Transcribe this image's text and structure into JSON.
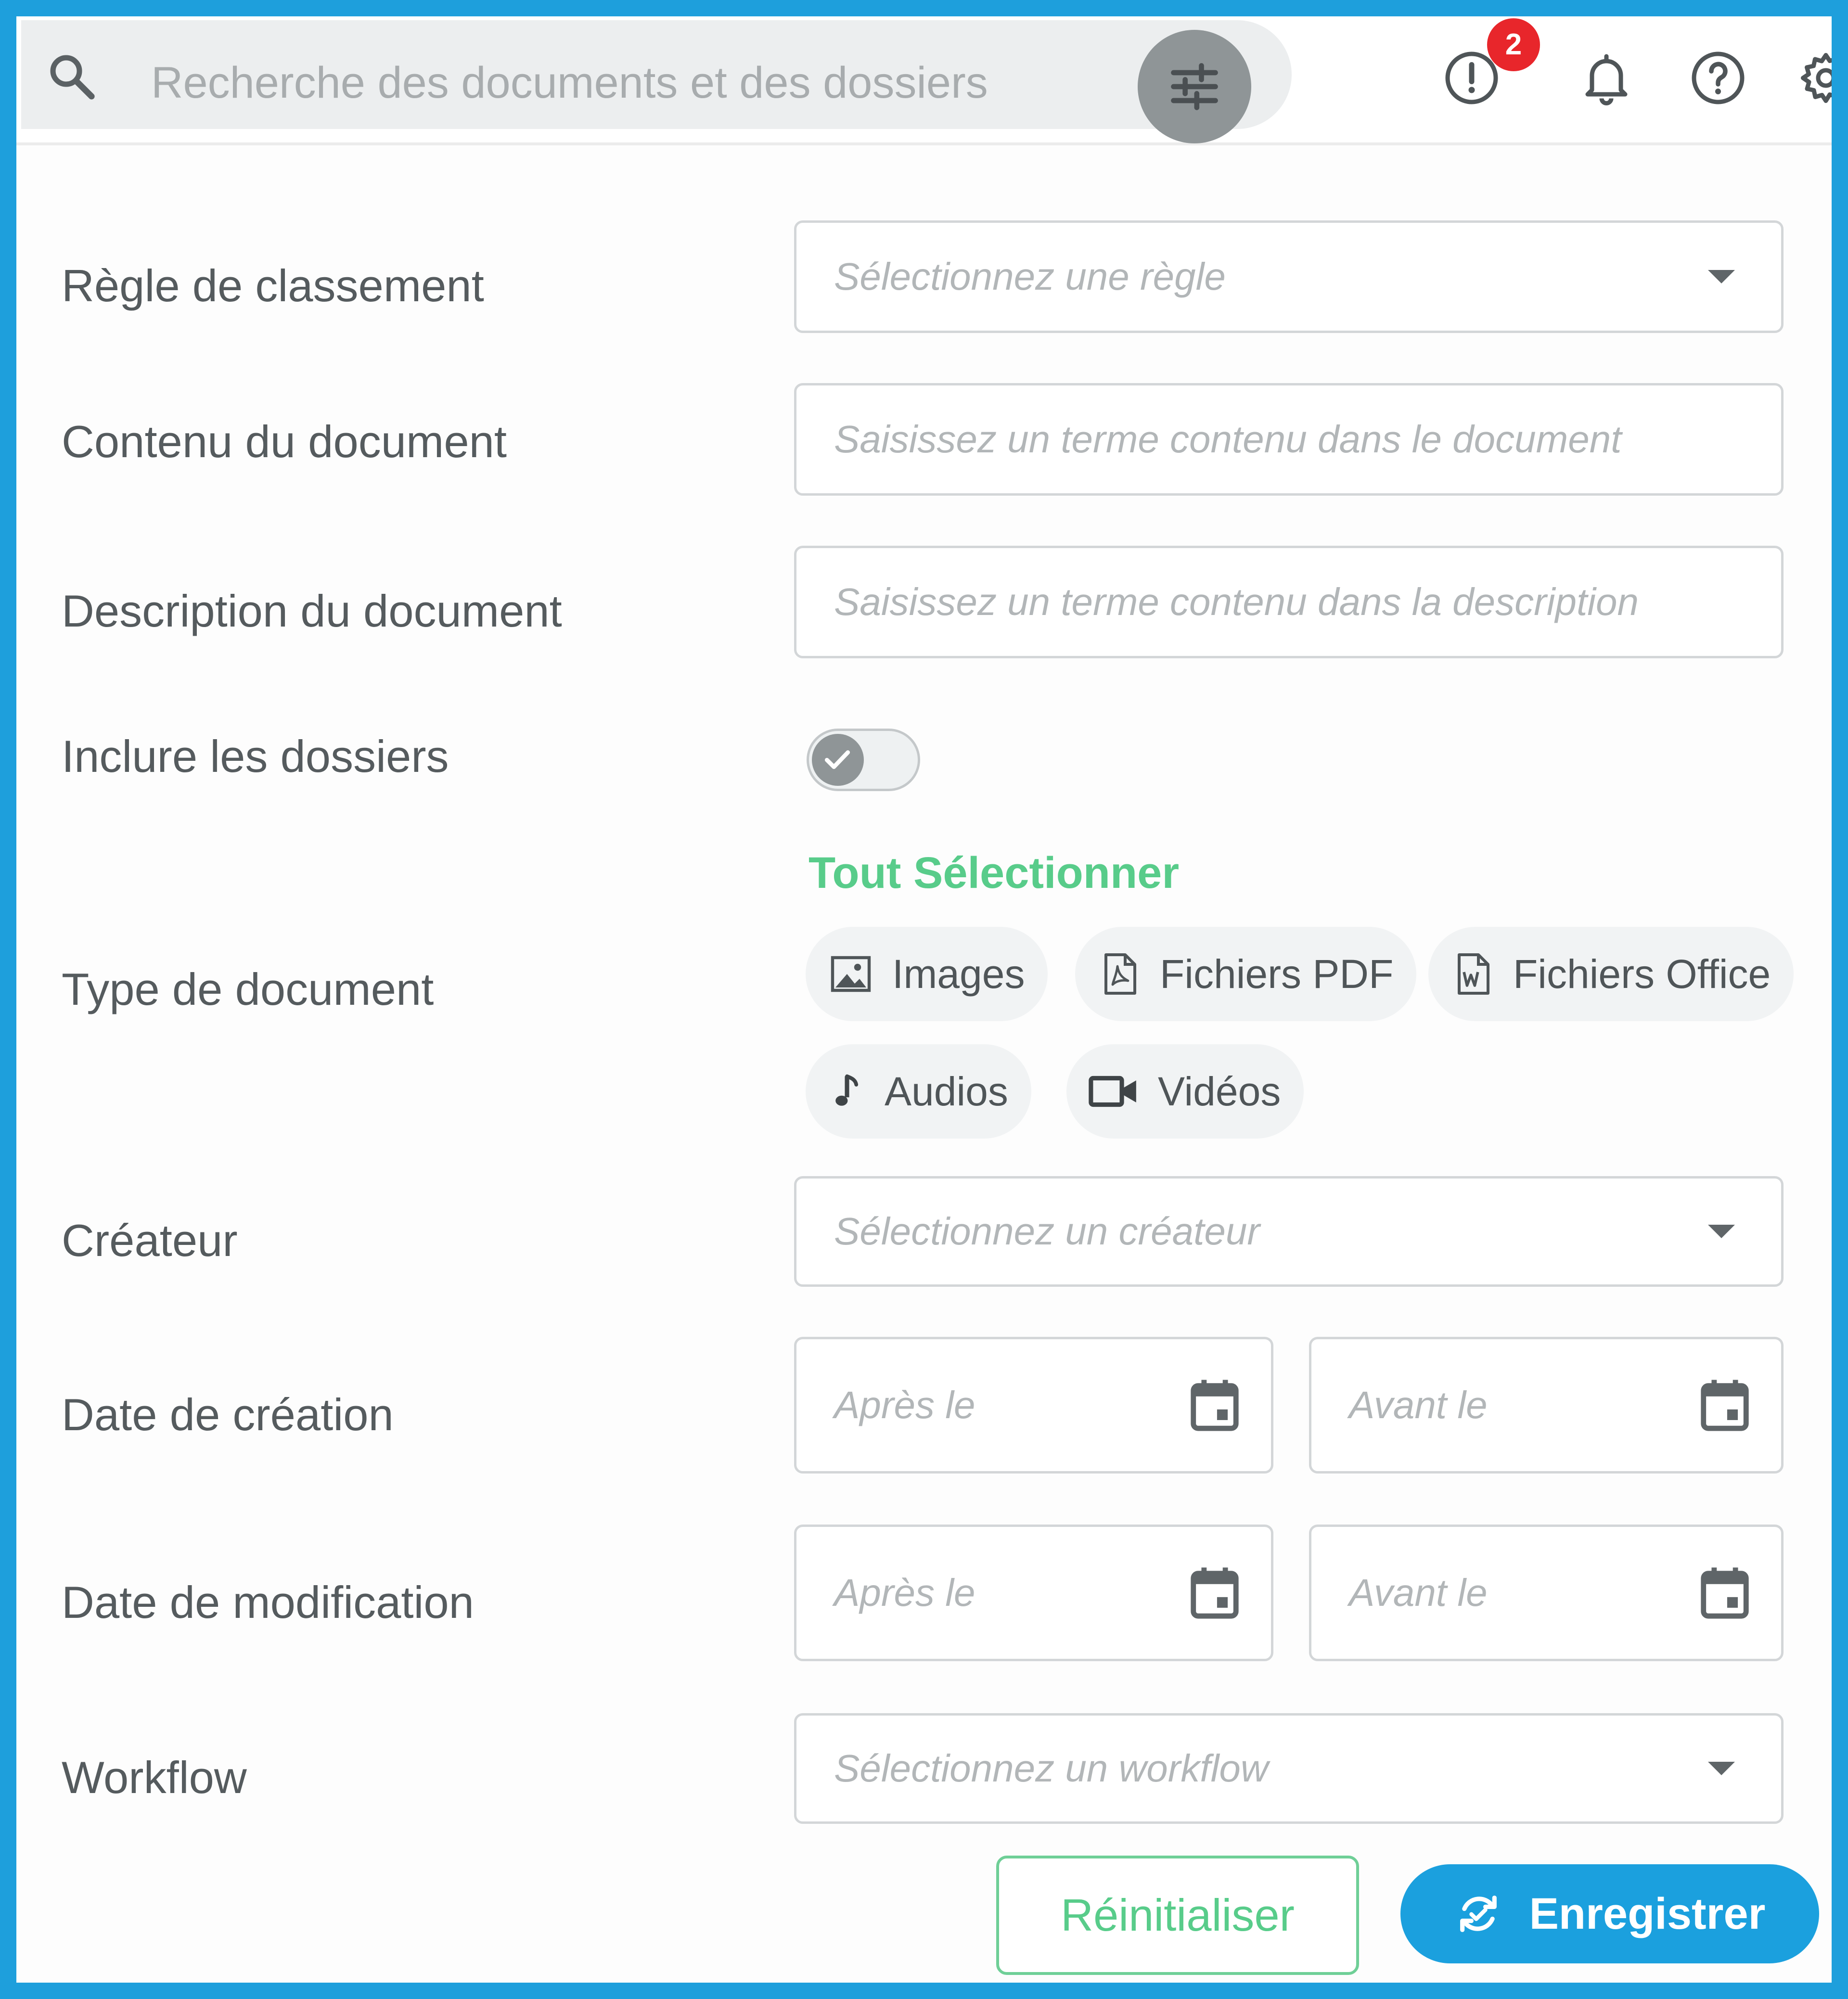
{
  "search": {
    "placeholder": "Recherche des documents et des dossiers",
    "search_icon": "search-icon",
    "filter_icon": "tune-sliders-icon"
  },
  "header_icons": {
    "alert_icon": "alert-circle-icon",
    "alert_badge_count": "2",
    "bell_icon": "bell-icon",
    "help_icon": "help-circle-icon",
    "settings_icon": "gear-icon"
  },
  "form": {
    "rule": {
      "label": "Règle de classement",
      "placeholder": "Sélectionnez une règle"
    },
    "content": {
      "label": "Contenu du document",
      "placeholder": "Saisissez un terme contenu dans le document"
    },
    "description": {
      "label": "Description du document",
      "placeholder": "Saisissez un terme contenu dans la description"
    },
    "include_folders": {
      "label": "Inclure les dossiers",
      "checked": true
    },
    "doc_type": {
      "label": "Type de document",
      "select_all": "Tout Sélectionner",
      "chips": [
        {
          "label": "Images",
          "icon": "image-icon"
        },
        {
          "label": "Fichiers PDF",
          "icon": "pdf-file-icon"
        },
        {
          "label": "Fichiers Office",
          "icon": "word-file-icon"
        },
        {
          "label": "Audios",
          "icon": "music-note-icon"
        },
        {
          "label": "Vidéos",
          "icon": "video-camera-icon"
        }
      ]
    },
    "creator": {
      "label": "Créateur",
      "placeholder": "Sélectionnez un créateur"
    },
    "creation_date": {
      "label": "Date de création",
      "after": "Après le",
      "before": "Avant le"
    },
    "modification_date": {
      "label": "Date de modification",
      "after": "Après le",
      "before": "Avant le"
    },
    "workflow": {
      "label": "Workflow",
      "placeholder": "Sélectionnez un workflow"
    }
  },
  "actions": {
    "reset": "Réinitialiser",
    "save": "Enregistrer",
    "save_icon": "refresh-save-icon"
  },
  "colors": {
    "accent_blue": "#1ba0de",
    "accent_green": "#58cc8a",
    "badge_red": "#e8262b"
  }
}
